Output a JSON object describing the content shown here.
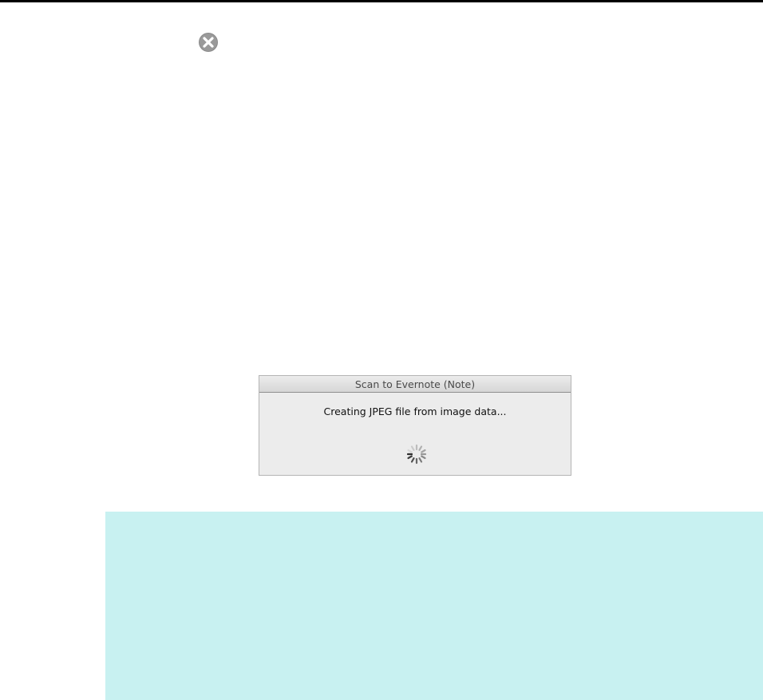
{
  "page": {
    "close_icon": "close-circle-icon",
    "spinner_icon": "loading-spinner-icon"
  },
  "dialog": {
    "title": "Scan to Evernote (Note)",
    "message": "Creating JPEG file from image data..."
  },
  "colors": {
    "top_rule": "#000000",
    "close_icon_fill": "#8a8a8a",
    "dialog_background": "#ececec",
    "note_panel": "#c8f1f1"
  }
}
